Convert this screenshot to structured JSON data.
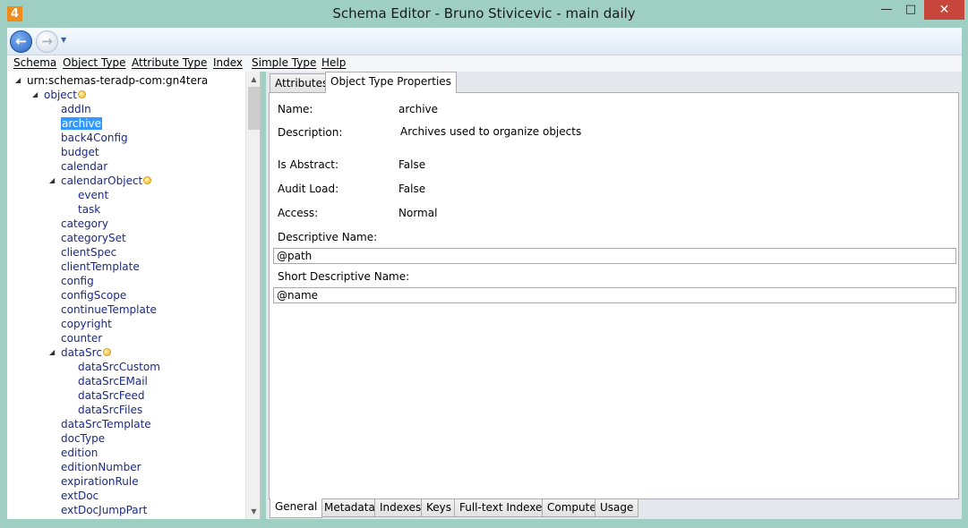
{
  "window": {
    "title": "Schema Editor - Bruno Stivicevic - main daily",
    "app_icon_label": "4",
    "minimize_glyph": "—",
    "maximize_glyph": "□",
    "close_glyph": "✕"
  },
  "toolbar": {
    "back_glyph": "←",
    "forward_glyph": "→",
    "dropdown_glyph": "▼"
  },
  "menu": [
    "Schema",
    "Object Type",
    "Attribute Type",
    "Index",
    "Simple Type",
    "Help"
  ],
  "tree": {
    "root": "urn:schemas-teradp-com:gn4tera",
    "object": "object",
    "items": [
      {
        "label": "addIn"
      },
      {
        "label": "archive",
        "selected": true
      },
      {
        "label": "back4Config"
      },
      {
        "label": "budget"
      },
      {
        "label": "calendar"
      },
      {
        "label": "calendarObject",
        "expanded": true,
        "badge": true
      },
      {
        "label": "event",
        "child": true
      },
      {
        "label": "task",
        "child": true
      },
      {
        "label": "category"
      },
      {
        "label": "categorySet"
      },
      {
        "label": "clientSpec"
      },
      {
        "label": "clientTemplate"
      },
      {
        "label": "config"
      },
      {
        "label": "configScope"
      },
      {
        "label": "continueTemplate"
      },
      {
        "label": "copyright"
      },
      {
        "label": "counter"
      },
      {
        "label": "dataSrc",
        "expanded": true,
        "badge": true
      },
      {
        "label": "dataSrcCustom",
        "child": true
      },
      {
        "label": "dataSrcEMail",
        "child": true
      },
      {
        "label": "dataSrcFeed",
        "child": true
      },
      {
        "label": "dataSrcFiles",
        "child": true
      },
      {
        "label": "dataSrcTemplate"
      },
      {
        "label": "docType"
      },
      {
        "label": "edition"
      },
      {
        "label": "editionNumber"
      },
      {
        "label": "expirationRule"
      },
      {
        "label": "extDoc"
      },
      {
        "label": "extDocJumpPart"
      }
    ]
  },
  "tabs_top": [
    "Attributes",
    "Object Type Properties"
  ],
  "properties": {
    "name_label": "Name:",
    "name_value": "archive",
    "description_label": "Description:",
    "description_value": "Archives used to organize objects",
    "is_abstract_label": "Is Abstract:",
    "is_abstract_value": "False",
    "audit_load_label": "Audit Load:",
    "audit_load_value": "False",
    "access_label": "Access:",
    "access_value": "Normal",
    "descriptive_name_label": "Descriptive Name:",
    "descriptive_name_value": "@path",
    "short_descriptive_name_label": "Short Descriptive Name:",
    "short_descriptive_name_value": "@name"
  },
  "tabs_bottom": [
    "General",
    "Metadata",
    "Indexes",
    "Keys",
    "Full-text Indexes",
    "Compute",
    "Usage"
  ],
  "colors": {
    "title_bar": "#9fcfc3",
    "selection": "#3399ff",
    "close_button": "#c7463b",
    "tree_text": "#1a2a8a"
  }
}
